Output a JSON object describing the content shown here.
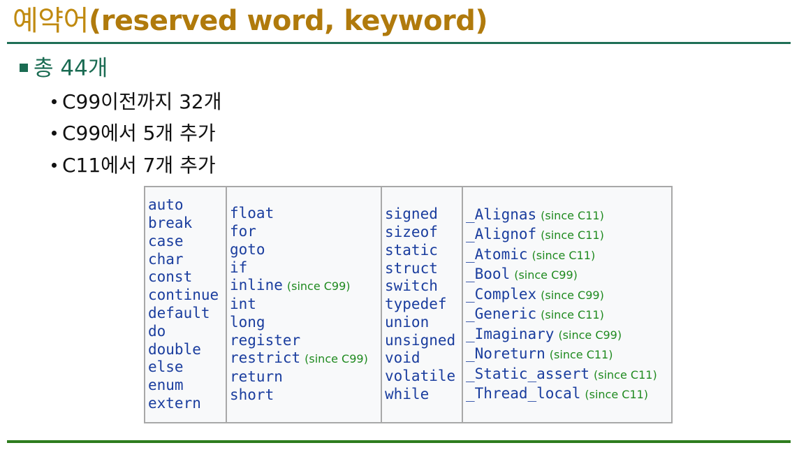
{
  "title": {
    "korean": "예약어",
    "english": "(reserved word, keyword)"
  },
  "bullet_main": "총 44개",
  "sub_bullets": [
    "C99이전까지 32개",
    "C99에서 5개 추가",
    "C11에서 7개 추가"
  ],
  "keyword_table": {
    "columns": [
      [
        {
          "kw": "auto",
          "note": ""
        },
        {
          "kw": "break",
          "note": ""
        },
        {
          "kw": "case",
          "note": ""
        },
        {
          "kw": "char",
          "note": ""
        },
        {
          "kw": "const",
          "note": ""
        },
        {
          "kw": "continue",
          "note": ""
        },
        {
          "kw": "default",
          "note": ""
        },
        {
          "kw": "do",
          "note": ""
        },
        {
          "kw": "double",
          "note": ""
        },
        {
          "kw": "else",
          "note": ""
        },
        {
          "kw": "enum",
          "note": ""
        },
        {
          "kw": "extern",
          "note": ""
        }
      ],
      [
        {
          "kw": "float",
          "note": ""
        },
        {
          "kw": "for",
          "note": ""
        },
        {
          "kw": "goto",
          "note": ""
        },
        {
          "kw": "if",
          "note": ""
        },
        {
          "kw": "inline",
          "note": "(since C99)"
        },
        {
          "kw": "int",
          "note": ""
        },
        {
          "kw": "long",
          "note": ""
        },
        {
          "kw": "register",
          "note": ""
        },
        {
          "kw": "restrict",
          "note": "(since C99)"
        },
        {
          "kw": "return",
          "note": ""
        },
        {
          "kw": "short",
          "note": ""
        }
      ],
      [
        {
          "kw": "signed",
          "note": ""
        },
        {
          "kw": "sizeof",
          "note": ""
        },
        {
          "kw": "static",
          "note": ""
        },
        {
          "kw": "struct",
          "note": ""
        },
        {
          "kw": "switch",
          "note": ""
        },
        {
          "kw": "typedef",
          "note": ""
        },
        {
          "kw": "union",
          "note": ""
        },
        {
          "kw": "unsigned",
          "note": ""
        },
        {
          "kw": "void",
          "note": ""
        },
        {
          "kw": "volatile",
          "note": ""
        },
        {
          "kw": "while",
          "note": ""
        }
      ],
      [
        {
          "kw": "_Alignas",
          "note": "(since C11)"
        },
        {
          "kw": "_Alignof",
          "note": "(since C11)"
        },
        {
          "kw": "_Atomic",
          "note": "(since C11)"
        },
        {
          "kw": "_Bool",
          "note": "(since C99)"
        },
        {
          "kw": "_Complex",
          "note": "(since C99)"
        },
        {
          "kw": "_Generic",
          "note": "(since C11)"
        },
        {
          "kw": "_Imaginary",
          "note": "(since C99)"
        },
        {
          "kw": "_Noreturn",
          "note": "(since C11)"
        },
        {
          "kw": "_Static_assert",
          "note": "(since C11)"
        },
        {
          "kw": "_Thread_local",
          "note": "(since C11)"
        }
      ]
    ]
  },
  "colors": {
    "title": "#b8860b",
    "rule_top": "#1f6f56",
    "rule_bottom": "#2e7d1e",
    "bullet_main": "#1a6b52",
    "keyword": "#1a3d9e",
    "since_note": "#1f8a1f"
  }
}
